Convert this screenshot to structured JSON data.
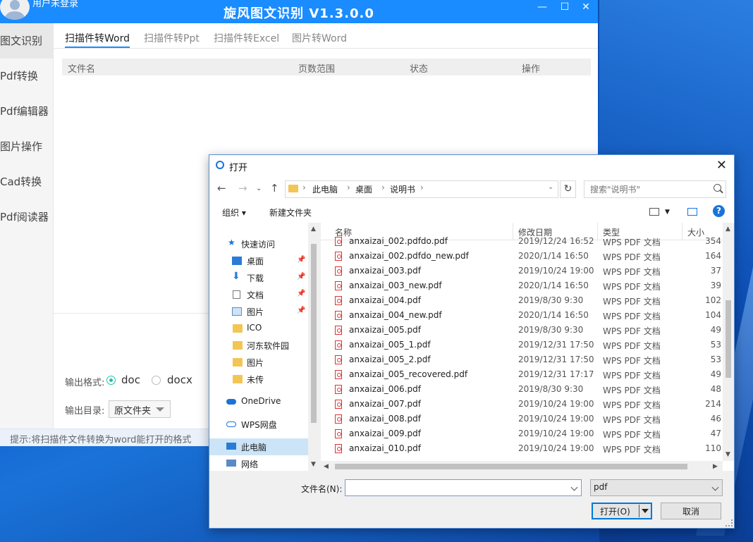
{
  "app": {
    "title": "旋风图文识别 V1.3.0.0",
    "login_text": "用户未登录",
    "window_buttons": {
      "minimize": "—",
      "maximize": "☐",
      "close": "✕"
    },
    "sidebar": [
      "图文识别",
      "Pdf转换",
      "Pdf编辑器",
      "图片操作",
      "Cad转换",
      "Pdf阅读器"
    ],
    "tabs": [
      "扫描件转Word",
      "扫描件转Ppt",
      "扫描件转Excel",
      "图片转Word"
    ],
    "table_headers": [
      "文件名",
      "页数范围",
      "状态",
      "操作"
    ],
    "output_format_label": "输出格式:",
    "format_options": [
      "doc",
      "docx"
    ],
    "output_dir_label": "输出目录:",
    "output_dir_value": "原文件夹",
    "hint": "提示:将扫描件文件转换为word能打开的格式"
  },
  "dialog": {
    "title": "打开",
    "breadcrumb": [
      "此电脑",
      "桌面",
      "说明书"
    ],
    "search_placeholder": "搜索\"说明书\"",
    "toolbar": {
      "organize": "组织 ▾",
      "new_folder": "新建文件夹"
    },
    "nav": [
      {
        "label": "快速访问",
        "icon": "star-icon"
      },
      {
        "label": "桌面",
        "icon": "desktop-icon",
        "pinned": true
      },
      {
        "label": "下载",
        "icon": "download-icon",
        "pinned": true
      },
      {
        "label": "文档",
        "icon": "document-icon",
        "pinned": true
      },
      {
        "label": "图片",
        "icon": "picture-icon",
        "pinned": true
      },
      {
        "label": "ICO",
        "icon": "folder-icon"
      },
      {
        "label": "河东软件园",
        "icon": "folder-icon"
      },
      {
        "label": "图片",
        "icon": "folder-icon"
      },
      {
        "label": "未传",
        "icon": "folder-icon"
      },
      {
        "label": "OneDrive",
        "icon": "cloud-icon"
      },
      {
        "label": "WPS网盘",
        "icon": "cloud-icon"
      },
      {
        "label": "此电脑",
        "icon": "computer-icon",
        "selected": true
      },
      {
        "label": "网络",
        "icon": "network-icon"
      }
    ],
    "columns": [
      "名称",
      "修改日期",
      "类型",
      "大小"
    ],
    "files": [
      {
        "name": "anxaizai_002.pdfdo.pdf",
        "date": "2019/12/24 16:52",
        "type": "WPS PDF 文档",
        "size": "354"
      },
      {
        "name": "anxaizai_002.pdfdo_new.pdf",
        "date": "2020/1/14 16:50",
        "type": "WPS PDF 文档",
        "size": "164"
      },
      {
        "name": "anxaizai_003.pdf",
        "date": "2019/10/24 19:00",
        "type": "WPS PDF 文档",
        "size": "37"
      },
      {
        "name": "anxaizai_003_new.pdf",
        "date": "2020/1/14 16:50",
        "type": "WPS PDF 文档",
        "size": "39"
      },
      {
        "name": "anxaizai_004.pdf",
        "date": "2019/8/30 9:30",
        "type": "WPS PDF 文档",
        "size": "102"
      },
      {
        "name": "anxaizai_004_new.pdf",
        "date": "2020/1/14 16:50",
        "type": "WPS PDF 文档",
        "size": "104"
      },
      {
        "name": "anxaizai_005.pdf",
        "date": "2019/8/30 9:30",
        "type": "WPS PDF 文档",
        "size": "49"
      },
      {
        "name": "anxaizai_005_1.pdf",
        "date": "2019/12/31 17:50",
        "type": "WPS PDF 文档",
        "size": "53"
      },
      {
        "name": "anxaizai_005_2.pdf",
        "date": "2019/12/31 17:50",
        "type": "WPS PDF 文档",
        "size": "53"
      },
      {
        "name": "anxaizai_005_recovered.pdf",
        "date": "2019/12/31 17:17",
        "type": "WPS PDF 文档",
        "size": "49"
      },
      {
        "name": "anxaizai_006.pdf",
        "date": "2019/8/30 9:30",
        "type": "WPS PDF 文档",
        "size": "48"
      },
      {
        "name": "anxaizai_007.pdf",
        "date": "2019/10/24 19:00",
        "type": "WPS PDF 文档",
        "size": "214"
      },
      {
        "name": "anxaizai_008.pdf",
        "date": "2019/10/24 19:00",
        "type": "WPS PDF 文档",
        "size": "46"
      },
      {
        "name": "anxaizai_009.pdf",
        "date": "2019/10/24 19:00",
        "type": "WPS PDF 文档",
        "size": "47"
      },
      {
        "name": "anxaizai_010.pdf",
        "date": "2019/10/24 19:00",
        "type": "WPS PDF 文档",
        "size": "110"
      }
    ],
    "filename_label": "文件名(N):",
    "filename_value": "",
    "filetype_value": "pdf",
    "open_label": "打开(O)",
    "cancel_label": "取消"
  },
  "colors": {
    "accent": "#1a8cff",
    "radio_on": "#1ec4a8",
    "selection": "#cce4f7"
  }
}
